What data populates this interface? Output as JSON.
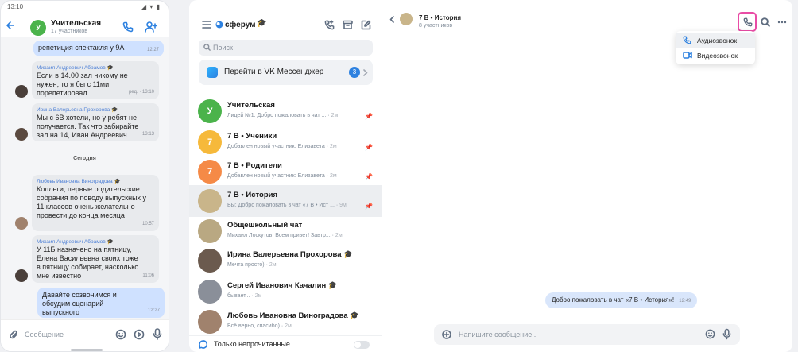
{
  "phone": {
    "time": "13:10",
    "signal": "◢ ▾ ▮",
    "title": "Учительская",
    "subtitle": "17 участников",
    "avatar_letter": "У",
    "messages": [
      {
        "mine": true,
        "text": "репетиция спектакля у 9А",
        "time": "12:27"
      },
      {
        "mine": false,
        "author": "Михаил Андреевич Абрамов 🎓",
        "text": "Если в 14.00 зал никому не нужен, то я бы с 11ми порепетировал",
        "time": "ред. · 13:10"
      },
      {
        "mine": false,
        "author": "Ирина Валерьевна Прохорова 🎓",
        "text": "Мы с 6В хотели, но у ребят не получается. Так что забирайте зал на 14, Иван Андреевич",
        "time": "13:13"
      },
      {
        "mine": false,
        "author": "Любовь Ивановна Виноградова 🎓",
        "text": "Коллеги, первые родительские собрания по поводу выпускных у 11 классов очень желательно провести до конца месяца",
        "time": "10:57"
      },
      {
        "mine": false,
        "author": "Михаил Андреевич Абрамов 🎓",
        "text": "У 11Б назначено на пятницу, Елена Васильевна своих тоже в пятницу собирает, насколько мне известно",
        "time": "11:06"
      },
      {
        "mine": true,
        "text": "Давайте созвонимся и обсудим сценарий выпускного",
        "time": "12:27"
      }
    ],
    "day_separator": "Сегодня",
    "input_placeholder": "Сообщение"
  },
  "list": {
    "brand": "сферум",
    "search_placeholder": "Поиск",
    "vk_banner": "Перейти в VK Мессенджер",
    "vk_badge": "3",
    "chats": [
      {
        "name": "Учительская",
        "preview": "Лицей №1:   Добро пожаловать в чат ...",
        "time": "2м",
        "pinned": true,
        "avatar": "У",
        "color": "#4bb34b"
      },
      {
        "name": "7 В • Ученики",
        "preview": "Добавлен новый участник: Елизавета",
        "time": "2м",
        "pinned": true,
        "avatar": "7",
        "color": "#f6b93b"
      },
      {
        "name": "7 В • Родители",
        "preview": "Добавлен новый участник: Елизавета",
        "time": "2м",
        "pinned": true,
        "avatar": "7",
        "color": "#f58a47"
      },
      {
        "name": "7 В • История",
        "preview": "Вы: Добро пожаловать в чат «7 В • Ист ...",
        "time": "9м",
        "pinned": true,
        "avatar": "",
        "color": "#c9b58a"
      },
      {
        "name": "Общешкольный чат",
        "preview": "Михаил Лоскутов: Всем привет! Завтр...",
        "time": "2м",
        "pinned": false,
        "avatar": "",
        "color": "#b9a882"
      },
      {
        "name": "Ирина Валерьевна Прохорова 🎓",
        "preview": "Мечта просто)",
        "time": "2м",
        "pinned": false,
        "avatar": "",
        "color": "#6b5a4e"
      },
      {
        "name": "Сергей Иванович Качалин 🎓",
        "preview": "бывает...",
        "time": "2м",
        "pinned": false,
        "avatar": "",
        "color": "#8a8f99"
      },
      {
        "name": "Любовь Ивановна Виноградова 🎓",
        "preview": "Всё верно, спасибо)",
        "time": "2м",
        "pinned": false,
        "avatar": "",
        "color": "#a0826d"
      }
    ],
    "footer_label": "Только непрочитанные"
  },
  "conversation": {
    "title": "7 В • История",
    "subtitle": "8 участников",
    "menu": {
      "audio": "Аудиозвонок",
      "video": "Видеозвонок"
    },
    "system_message": "Добро пожаловать в чат «7 В • История»!",
    "system_time": "12:49",
    "input_placeholder": "Напишите сообщение..."
  },
  "colors": {
    "accent": "#2d81e0",
    "highlight": "#e94ca6",
    "mine_bubble": "#cfe1ff"
  }
}
